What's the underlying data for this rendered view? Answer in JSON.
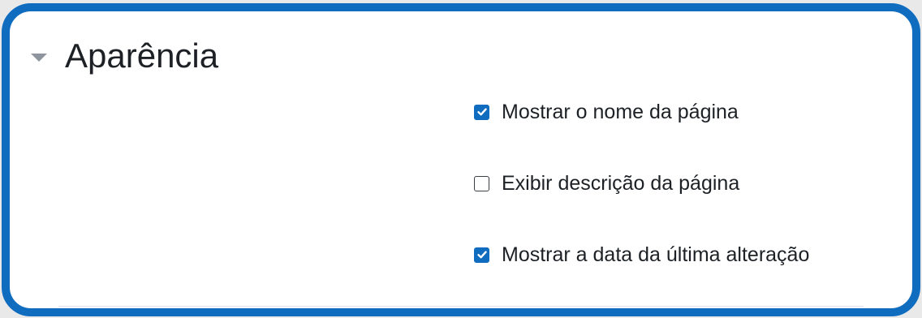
{
  "section": {
    "title": "Aparência",
    "toggle_icon": "caret-down-icon",
    "expanded": true
  },
  "options": [
    {
      "label": "Mostrar o nome da página",
      "checked": true
    },
    {
      "label": "Exibir descrição da página",
      "checked": false
    },
    {
      "label": "Mostrar a data da última alteração",
      "checked": true
    }
  ],
  "colors": {
    "accent": "#0f6cbf",
    "text": "#1d2125",
    "caret": "#8f959e"
  }
}
